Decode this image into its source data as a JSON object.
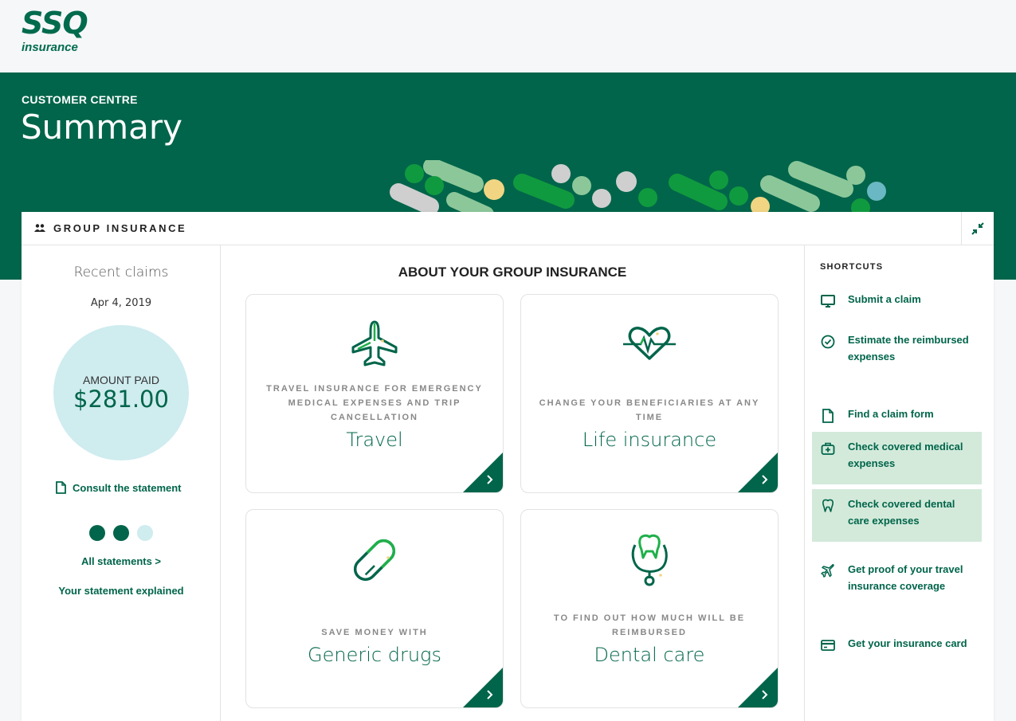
{
  "brand": {
    "logo_top": "SSQ",
    "logo_bottom": "insurance",
    "primary_color": "#00654a"
  },
  "hero": {
    "eyebrow": "CUSTOMER CENTRE",
    "title": "Summary"
  },
  "group": {
    "title": "GROUP INSURANCE",
    "icon": "people-icon",
    "collapse_icon": "collapse-icon"
  },
  "recent": {
    "title": "Recent claims",
    "date": "Apr 4, 2019",
    "amount_label": "AMOUNT PAID",
    "amount_value": "$281.00",
    "consult_label": "Consult the statement",
    "carousel_total": 3,
    "carousel_active": 3,
    "all_statements": "All statements >",
    "explained": "Your statement explained"
  },
  "about": {
    "title": "ABOUT YOUR GROUP INSURANCE",
    "tiles": [
      {
        "icon": "plane-icon",
        "desc": "TRAVEL INSURANCE FOR EMERGENCY MEDICAL EXPENSES AND TRIP CANCELLATION",
        "name": "Travel"
      },
      {
        "icon": "heartbeat-icon",
        "desc": "CHANGE YOUR BENEFICIARIES AT ANY TIME",
        "name": "Life insurance"
      },
      {
        "icon": "pill-icon",
        "desc": "SAVE MONEY WITH",
        "name": "Generic drugs"
      },
      {
        "icon": "tooth-stethoscope-icon",
        "desc": "TO FIND OUT HOW MUCH WILL BE REIMBURSED",
        "name": "Dental care"
      }
    ]
  },
  "shortcuts": {
    "title": "SHORTCUTS",
    "items": [
      {
        "label": "Submit a claim",
        "icon": "monitor-icon",
        "highlight": false
      },
      {
        "label": "Estimate the reimbursed expenses",
        "icon": "check-circle-icon",
        "highlight": false
      },
      {
        "label": "Find a claim form",
        "icon": "document-icon",
        "highlight": false
      },
      {
        "label": "Check covered medical expenses",
        "icon": "medical-bag-icon",
        "highlight": true
      },
      {
        "label": "Check covered dental care expenses",
        "icon": "tooth-icon",
        "highlight": true
      },
      {
        "label": "Get proof of your travel insurance coverage",
        "icon": "plane-icon",
        "highlight": false
      },
      {
        "label": "Get your insurance card",
        "icon": "card-icon",
        "highlight": false
      }
    ]
  }
}
